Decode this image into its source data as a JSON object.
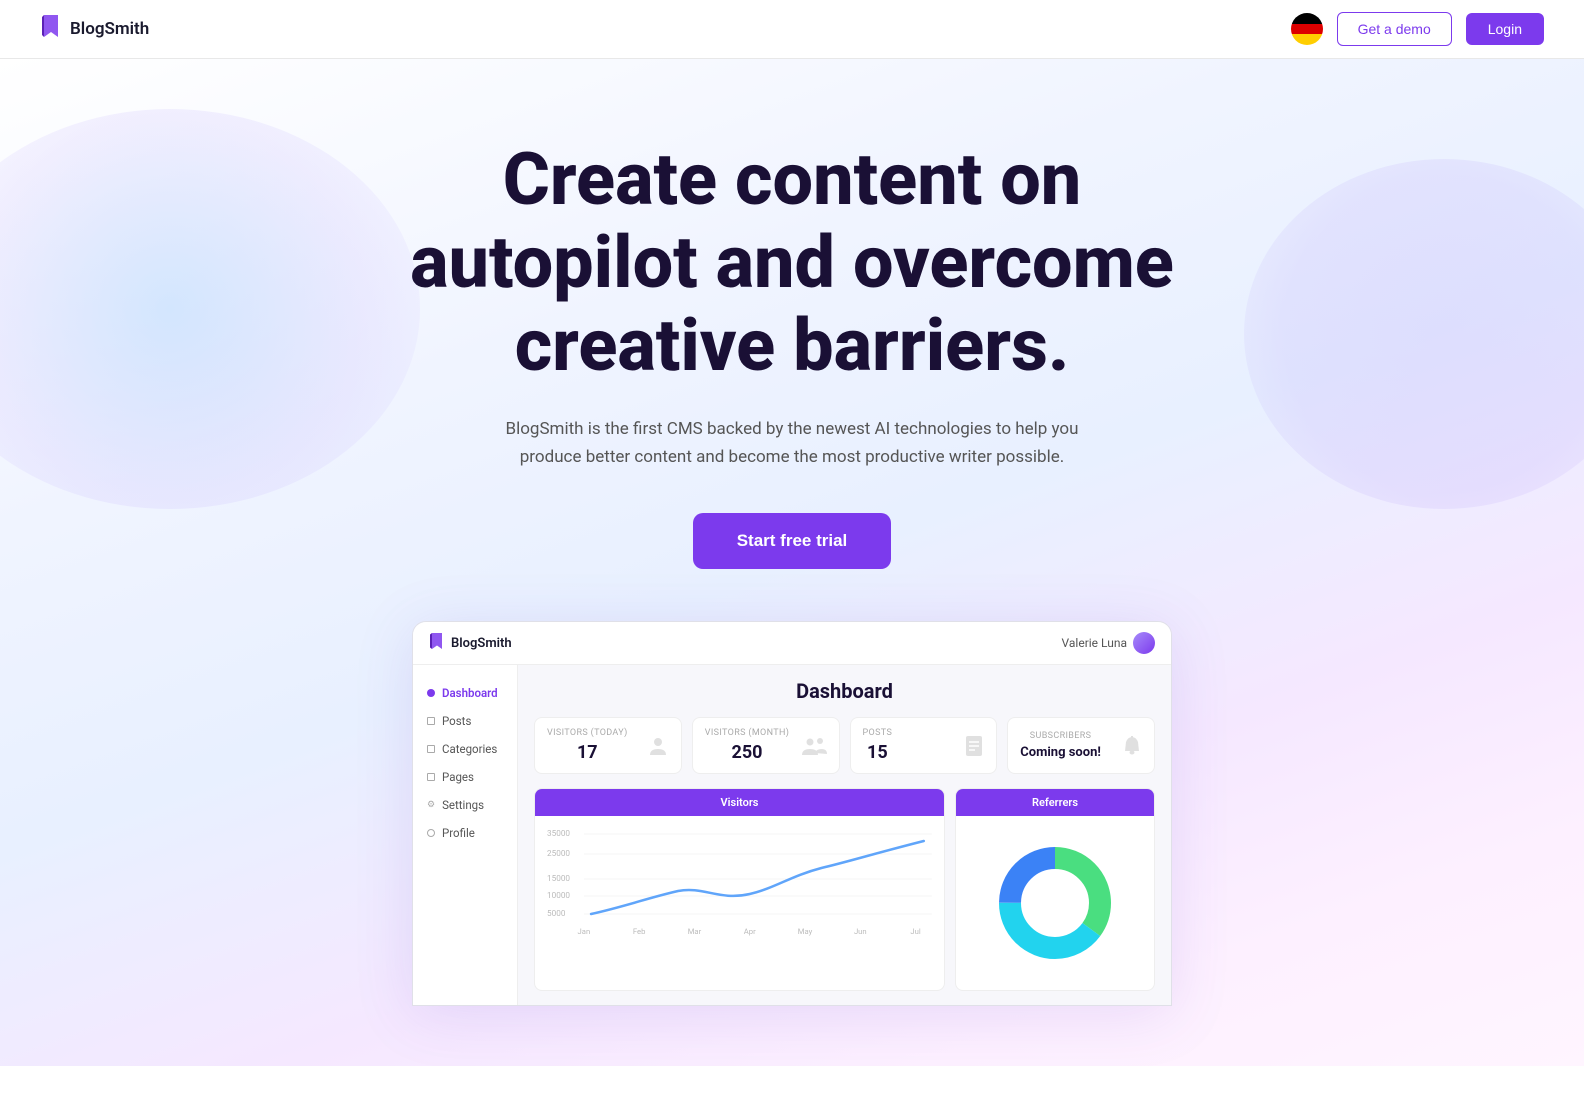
{
  "header": {
    "logo_text": "BlogSmith",
    "get_demo_label": "Get a demo",
    "login_label": "Login",
    "language": "German"
  },
  "hero": {
    "title": "Create content on autopilot and overcome creative barriers.",
    "subtitle": "BlogSmith is the first CMS backed by the newest AI technologies to help you produce better content and become the most productive writer possible.",
    "cta_label": "Start free trial"
  },
  "dashboard": {
    "logo_text": "BlogSmith",
    "user_name": "Valerie Luna",
    "page_title": "Dashboard",
    "nav": [
      {
        "label": "Dashboard",
        "active": true,
        "icon": "dot"
      },
      {
        "label": "Posts",
        "active": false,
        "icon": "rect"
      },
      {
        "label": "Categories",
        "active": false,
        "icon": "rect"
      },
      {
        "label": "Pages",
        "active": false,
        "icon": "rect"
      },
      {
        "label": "Settings",
        "active": false,
        "icon": "gear"
      },
      {
        "label": "Profile",
        "active": false,
        "icon": "dot-outline"
      }
    ],
    "stats": [
      {
        "label": "VISITORS (TODAY)",
        "value": "17",
        "icon": "person"
      },
      {
        "label": "VISITORS (MONTH)",
        "value": "250",
        "icon": "people"
      },
      {
        "label": "POSTS",
        "value": "15",
        "icon": "document"
      },
      {
        "label": "SUBSCRIBERS",
        "value": "Coming soon!",
        "icon": "bell",
        "small": true
      }
    ],
    "charts": {
      "visitors": {
        "title": "Visitors",
        "y_labels": [
          "35000",
          "25000",
          "15000",
          "10000",
          "5000"
        ],
        "x_labels": [
          "Jan",
          "Feb",
          "Mar",
          "Apr",
          "May",
          "Jun",
          "Jul"
        ]
      },
      "referrers": {
        "title": "Referrers",
        "segments": [
          {
            "color": "#4ade80",
            "pct": 35
          },
          {
            "color": "#22d3ee",
            "pct": 40
          },
          {
            "color": "#3b82f6",
            "pct": 25
          }
        ]
      }
    }
  }
}
